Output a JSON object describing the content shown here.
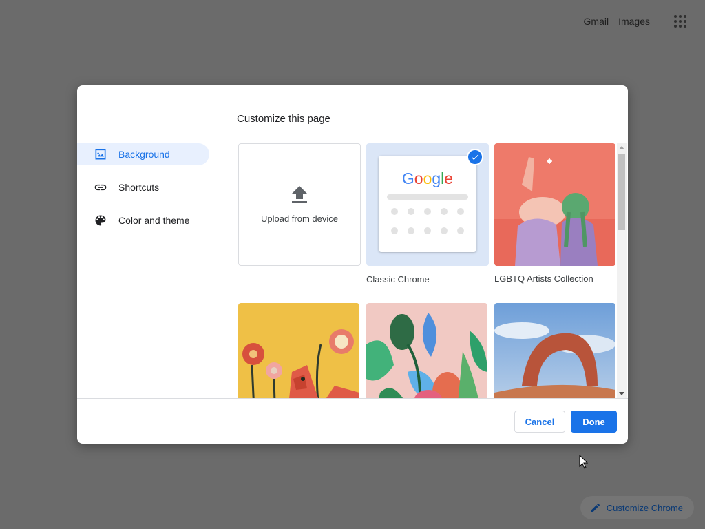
{
  "topbar": {
    "gmail": "Gmail",
    "images": "Images",
    "apps_icon": "apps-grid-icon"
  },
  "dialog": {
    "title": "Customize this page",
    "sidebar": [
      {
        "label": "Background",
        "icon": "image-icon",
        "active": true
      },
      {
        "label": "Shortcuts",
        "icon": "link-icon",
        "active": false
      },
      {
        "label": "Color and theme",
        "icon": "palette-icon",
        "active": false
      }
    ],
    "tiles": {
      "upload_label": "Upload from device",
      "classic_label": "Classic Chrome",
      "classic_logo": "Google",
      "lgbtq_label": "LGBTQ Artists Collection"
    },
    "buttons": {
      "cancel": "Cancel",
      "done": "Done"
    }
  },
  "customize_chrome": "Customize Chrome",
  "colors": {
    "accent": "#1a73e8",
    "active_bg": "#e8f0fe",
    "overlay": "#6b6b6b"
  }
}
